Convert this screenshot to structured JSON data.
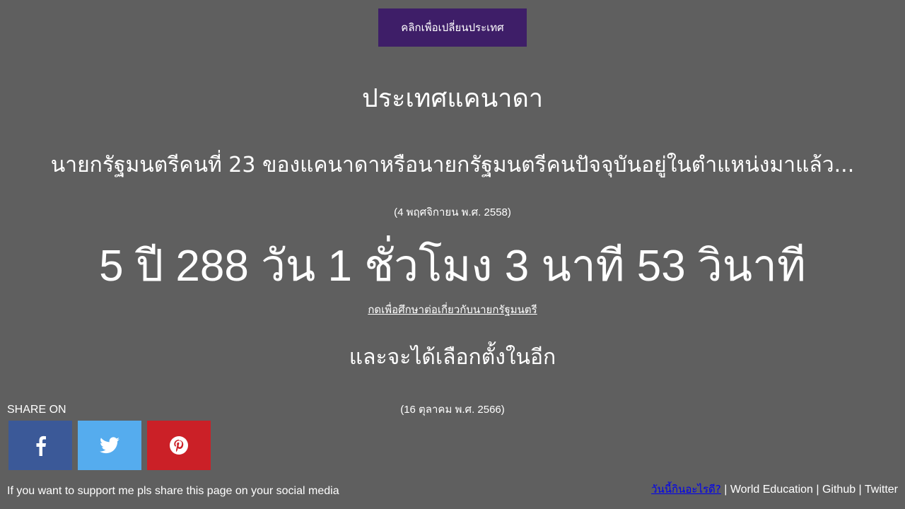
{
  "header": {
    "change_country_label": "คลิกเพื่อเปลี่ยนประเทศ"
  },
  "main": {
    "country_title": "ประเทศแคนาดา",
    "question": "นายกรัฐมนตรีคนที่ 23 ของแคนาดาหรือนายกรัฐมนตรีคนปัจจุบันอยู่ในตำแหน่งมาแล้ว...",
    "since_date": "(4 พฤศจิกายน พ.ศ. 2558)",
    "elapsed": "5 ปี 288 วัน 1 ชั่วโมง 3 นาที 53 วินาที",
    "learn_more_link": "กดเพื่อศึกษาต่อเกี่ยวกับนายกรัฐมนตรี",
    "election_label": "และจะได้เลือกตั้งในอีก",
    "election_date": "(16 ตุลาคม พ.ศ. 2566)"
  },
  "share": {
    "label": "SHARE ON",
    "buttons": [
      {
        "name": "facebook",
        "icon": "facebook-icon",
        "color": "#3b5998"
      },
      {
        "name": "twitter",
        "icon": "twitter-icon",
        "color": "#55acee"
      },
      {
        "name": "pinterest",
        "icon": "pinterest-icon",
        "color": "#cb2027"
      }
    ],
    "support_text": "If you want to support me pls share this page on your social media"
  },
  "footer": {
    "today_link": "วันนี้กินอะไรดี?",
    "separator": " | ",
    "world_education": "World Education",
    "github": "Github",
    "twitter": "Twitter"
  },
  "colors": {
    "background": "#5f5f5f",
    "button_purple": "#3e1e68",
    "link_blue": "#0000ee"
  }
}
